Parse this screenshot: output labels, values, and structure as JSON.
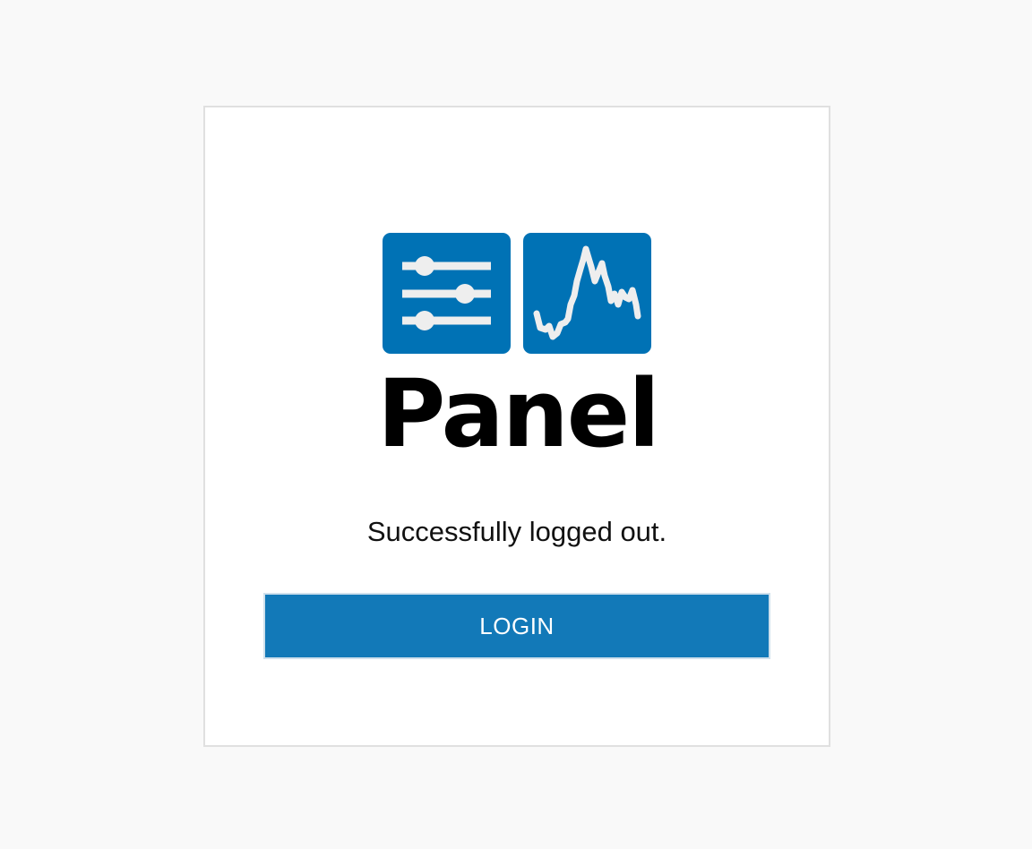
{
  "brand": {
    "wordmark": "Panel",
    "logo_color": "#0072b5",
    "logo_icons": [
      "sliders-icon",
      "line-chart-icon"
    ]
  },
  "logout": {
    "message": "Successfully logged out.",
    "login_label": "LOGIN",
    "button_color": "#1279b8"
  }
}
